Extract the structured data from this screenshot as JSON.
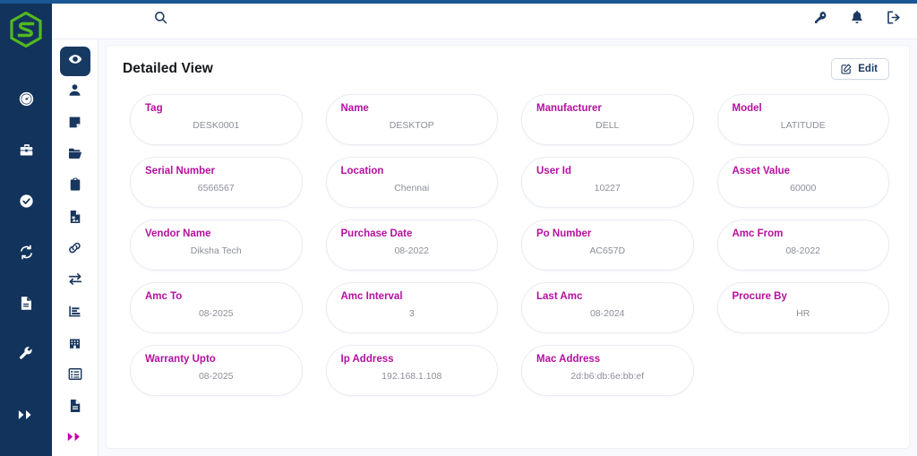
{
  "brand": {
    "logo_icon": "hexagon-s-logo",
    "accent_color": "#52b820"
  },
  "topbar": {
    "search_icon": "search-icon",
    "actions": [
      {
        "icon": "key-icon",
        "name": "change-password-button"
      },
      {
        "icon": "bell-icon",
        "name": "notifications-button"
      },
      {
        "icon": "logout-icon",
        "name": "logout-button"
      }
    ]
  },
  "primary_rail": {
    "items": [
      {
        "icon": "dashboard-gauge-icon",
        "name": "rail-item-dashboard"
      },
      {
        "icon": "toolbox-icon",
        "name": "rail-item-assets"
      },
      {
        "icon": "check-circle-icon",
        "name": "rail-item-approvals"
      },
      {
        "icon": "refresh-sync-icon",
        "name": "rail-item-sync"
      },
      {
        "icon": "document-icon",
        "name": "rail-item-reports"
      },
      {
        "icon": "wrench-icon",
        "name": "rail-item-maintenance"
      },
      {
        "icon": "double-chevron-right-icon",
        "name": "rail-item-expand"
      }
    ]
  },
  "icon_strip": {
    "items": [
      {
        "icon": "eye-icon",
        "name": "strip-item-detailed-view",
        "active": true,
        "accent": false
      },
      {
        "icon": "user-icon",
        "name": "strip-item-user",
        "active": false,
        "accent": false
      },
      {
        "icon": "note-icon",
        "name": "strip-item-notes",
        "active": false,
        "accent": false
      },
      {
        "icon": "folder-open-icon",
        "name": "strip-item-files",
        "active": false,
        "accent": false
      },
      {
        "icon": "clipboard-icon",
        "name": "strip-item-clipboard",
        "active": false,
        "accent": false
      },
      {
        "icon": "file-image-icon",
        "name": "strip-item-attachments",
        "active": false,
        "accent": false
      },
      {
        "icon": "link-chain-icon",
        "name": "strip-item-links",
        "active": false,
        "accent": false
      },
      {
        "icon": "transfer-arrows-icon",
        "name": "strip-item-transfer",
        "active": false,
        "accent": false
      },
      {
        "icon": "bar-chart-icon",
        "name": "strip-item-analytics",
        "active": false,
        "accent": false
      },
      {
        "icon": "building-icon",
        "name": "strip-item-department",
        "active": false,
        "accent": false
      },
      {
        "icon": "list-icon",
        "name": "strip-item-list",
        "active": false,
        "accent": false
      },
      {
        "icon": "file-text-icon",
        "name": "strip-item-documents",
        "active": false,
        "accent": false
      },
      {
        "icon": "double-chevron-right-icon",
        "name": "strip-item-more",
        "active": false,
        "accent": true
      }
    ]
  },
  "panel": {
    "title": "Detailed View",
    "edit_label": "Edit",
    "edit_icon": "edit-square-icon"
  },
  "fields": [
    {
      "label": "Tag",
      "value": "DESK0001"
    },
    {
      "label": "Name",
      "value": "DESKTOP"
    },
    {
      "label": "Manufacturer",
      "value": "DELL"
    },
    {
      "label": "Model",
      "value": "LATITUDE"
    },
    {
      "label": "Serial Number",
      "value": "6566567"
    },
    {
      "label": "Location",
      "value": "Chennai"
    },
    {
      "label": "User Id",
      "value": "10227"
    },
    {
      "label": "Asset Value",
      "value": "60000"
    },
    {
      "label": "Vendor Name",
      "value": "Diksha Tech"
    },
    {
      "label": "Purchase Date",
      "value": "08-2022"
    },
    {
      "label": "Po Number",
      "value": "AC657D"
    },
    {
      "label": "Amc From",
      "value": "08-2022"
    },
    {
      "label": "Amc To",
      "value": "08-2025"
    },
    {
      "label": "Amc Interval",
      "value": "3"
    },
    {
      "label": "Last Amc",
      "value": "08-2024"
    },
    {
      "label": "Procure By",
      "value": "HR"
    },
    {
      "label": "Warranty Upto",
      "value": "08-2025"
    },
    {
      "label": "Ip Address",
      "value": "192.168.1.108"
    },
    {
      "label": "Mac Address",
      "value": "2d:b6:db:6e:bb:ef"
    }
  ],
  "colors": {
    "rail_bg": "#12335c",
    "label": "#b5109e",
    "value": "#8b8f98",
    "accent_bar": "#1a5694",
    "logo_green": "#52b820",
    "strip_accent": "#c000a8"
  }
}
